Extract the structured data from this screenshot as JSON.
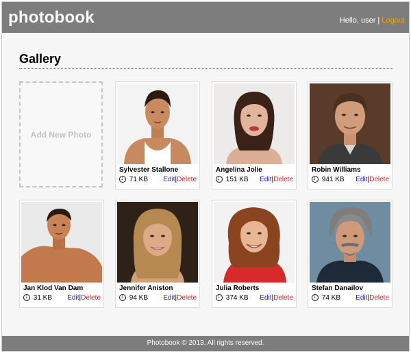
{
  "header": {
    "logo": "photobook",
    "greeting": "Hello, user",
    "separator": "|",
    "logout": "Logout"
  },
  "gallery": {
    "title": "Gallery",
    "add_label": "Add New Photo",
    "edit_label": "Edit",
    "delete_label": "Delete",
    "separator": "|",
    "photos": [
      {
        "name": "Sylvester Stallone",
        "size": "71 KB"
      },
      {
        "name": "Angelina Jolie",
        "size": "151 KB"
      },
      {
        "name": "Robin Williams",
        "size": "941 KB"
      },
      {
        "name": "Jan Klod Van Dam",
        "size": "31 KB"
      },
      {
        "name": "Jennifer Aniston",
        "size": "94 KB"
      },
      {
        "name": "Julia Roberts",
        "size": "374 KB"
      },
      {
        "name": "Stefan Danailov",
        "size": "74 KB"
      }
    ]
  },
  "footer": {
    "text": "Photobook © 2013. All rights reserved."
  },
  "colors": {
    "bar": "#7d7d7d",
    "logout": "#f3a000",
    "edit": "#1d1dcc",
    "delete": "#d42020"
  }
}
